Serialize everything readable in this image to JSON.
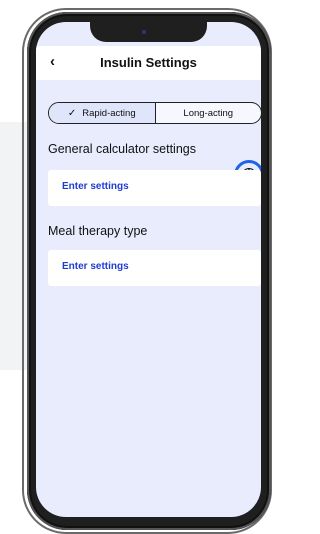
{
  "header": {
    "back": "‹",
    "title": "Insulin Settings"
  },
  "toggle": [
    {
      "label": "Rapid-acting",
      "check": "✓",
      "selected": true
    },
    {
      "label": "Long-acting",
      "selected": false
    }
  ],
  "sections": [
    {
      "title": "General calculator settings",
      "action": "Enter settings"
    },
    {
      "title": "Meal therapy type",
      "action": "Enter settings"
    }
  ],
  "info_icon": {
    "symbol": "i",
    "ring_color": "#1e63e8"
  },
  "colors": {
    "screen_bg": "#e8ecfd",
    "link": "#1f3bd6",
    "active_seg": "#dfe5fb"
  }
}
